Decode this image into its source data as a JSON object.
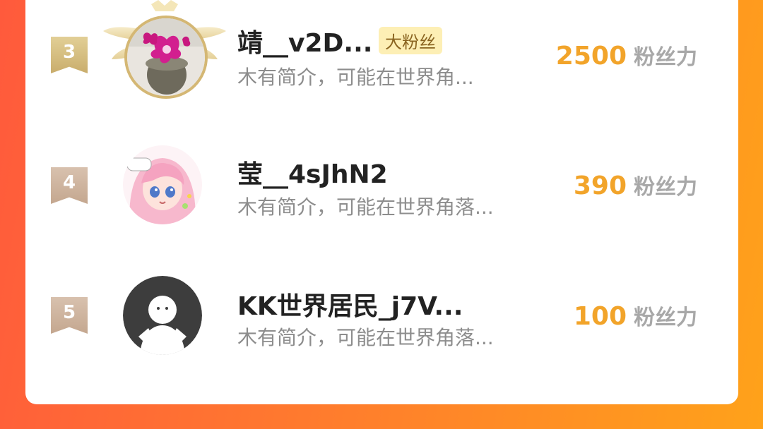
{
  "leaderboard": {
    "rows": [
      {
        "rank": "3",
        "name": "靖__v2D...",
        "badge": "大粉丝",
        "bio": "木有简介，可能在世界角...",
        "score": "2500",
        "score_unit": "粉丝力",
        "avatar_icon": "orchid-photo-avatar"
      },
      {
        "rank": "4",
        "name": "莹__4sJhN2",
        "bio": "木有简介，可能在世界角落...",
        "score": "390",
        "score_unit": "粉丝力",
        "avatar_icon": "anime-girl-avatar"
      },
      {
        "rank": "5",
        "name": "KK世界居民_j7V...",
        "bio": "木有简介，可能在世界角落...",
        "score": "100",
        "score_unit": "粉丝力",
        "avatar_icon": "default-user-avatar"
      }
    ]
  },
  "colors": {
    "accent": "#f2a42a",
    "background_start": "#ff5a3c",
    "background_end": "#ffa21a",
    "badge_bg": "#fdefb5"
  }
}
